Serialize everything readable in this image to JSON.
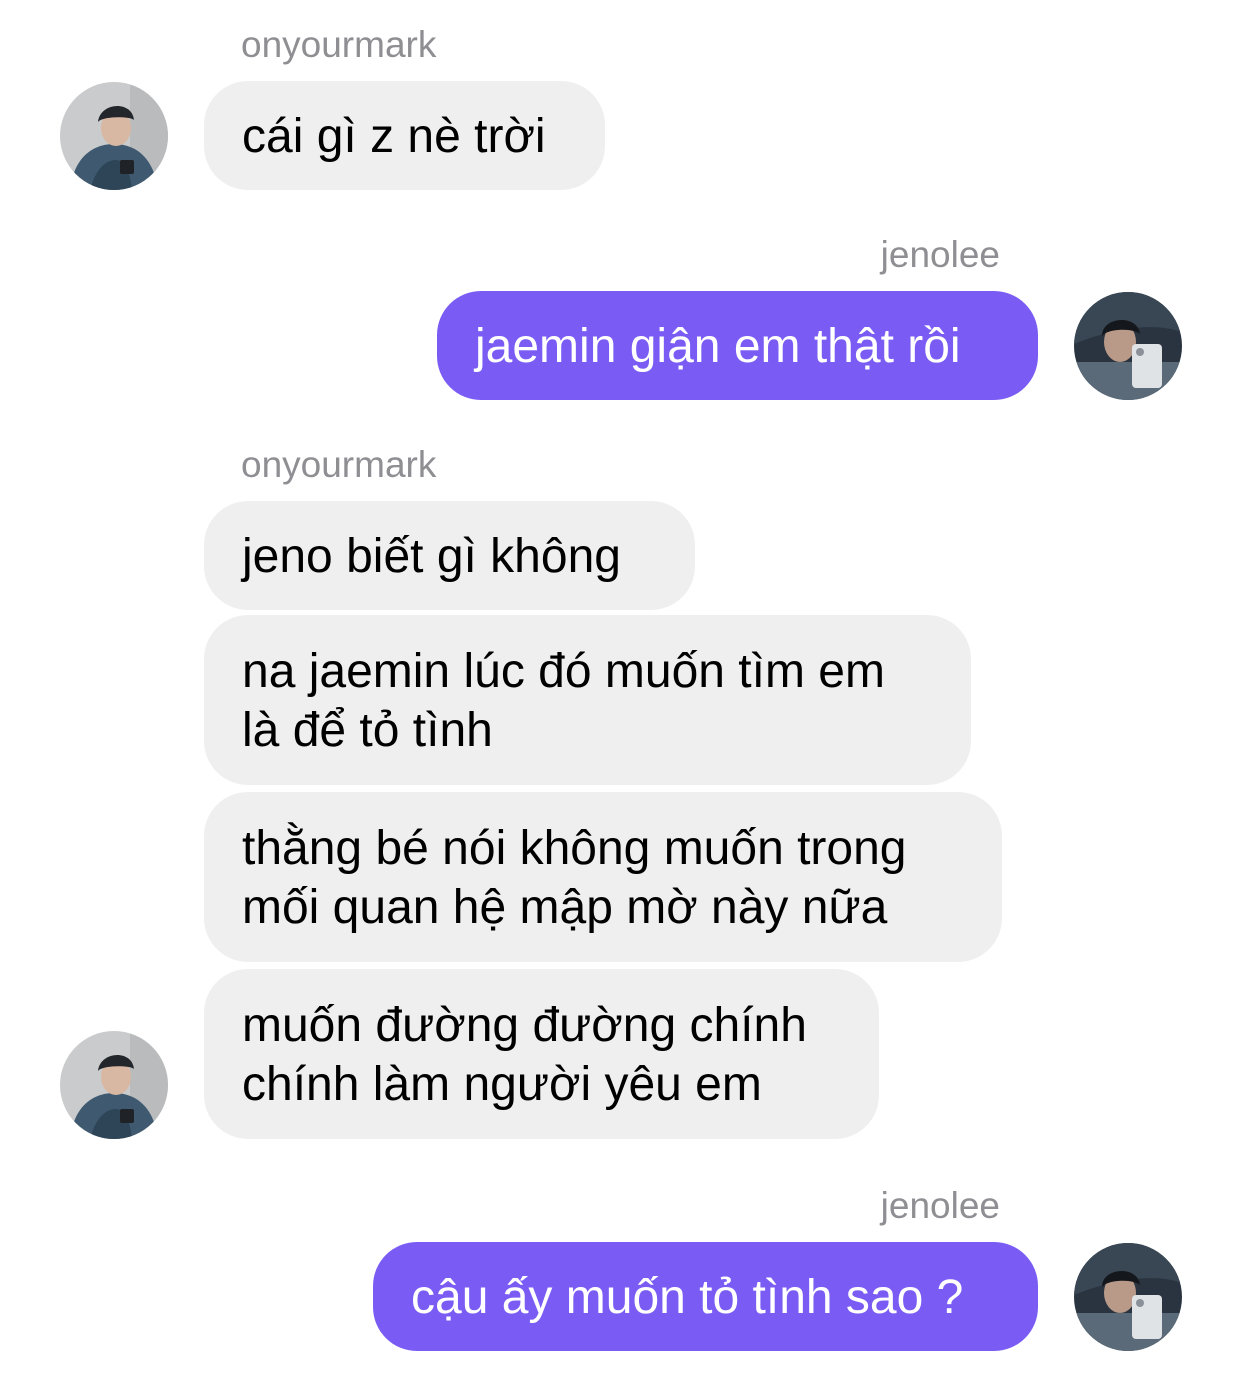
{
  "chat": {
    "messages": [
      {
        "sender": "onyourmark",
        "text": "cái gì z nè trời"
      },
      {
        "sender": "jenolee",
        "text": "jaemin giận em thật rồi"
      },
      {
        "sender": "onyourmark",
        "text": "jeno biết gì không"
      },
      {
        "sender": "onyourmark",
        "lines": [
          "na jaemin lúc đó muốn tìm em",
          "là để tỏ tình"
        ]
      },
      {
        "sender": "onyourmark",
        "lines": [
          "thằng bé nói không muốn trong",
          "mối quan hệ mập mờ này nữa"
        ]
      },
      {
        "sender": "onyourmark",
        "lines": [
          "muốn đường đường chính",
          "chính làm người yêu em"
        ]
      },
      {
        "sender": "jenolee",
        "text": "cậu ấy muốn tỏ tình sao ?"
      }
    ]
  },
  "colors": {
    "incoming_bubble": "#efefef",
    "outgoing_bubble": "#7a5cf5",
    "sender_name": "#8e8e93"
  },
  "icons": {
    "incoming_avatar": "onyourmark-avatar-icon",
    "outgoing_avatar": "jenolee-avatar-icon"
  }
}
